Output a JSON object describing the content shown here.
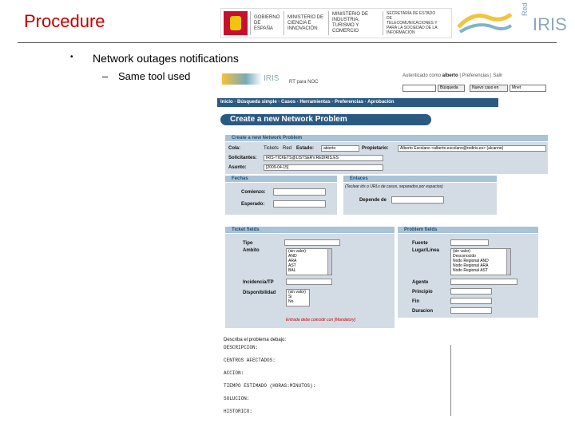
{
  "slide": {
    "title": "Procedure",
    "bullet_marker": "•",
    "bullet1": "Network outages notifications",
    "subbullet_dash": "–",
    "subbullet1": "Same tool used"
  },
  "header_logos": {
    "gov": "GOBIERNO DE ESPAÑA",
    "min1": "MINISTERIO DE CIENCIA E INNOVACIÓN",
    "min2": "MINISTERIO DE INDUSTRIA, TURISMO Y COMERCIO",
    "sec": "SECRETARÍA DE ESTADO DE TELECOMUNICACIONES Y PARA LA SOCIEDAD DE LA INFORMACIÓN",
    "red": "Red",
    "iris": "IRIS"
  },
  "app": {
    "logo_text": "IRIS",
    "subtitle": "RT para NOC",
    "auth_prefix": "Autenticado como",
    "user": "alberto",
    "prefs": "| Preferencias | Salir",
    "search_btn": "Búsqueda",
    "new_case_btn": "Nuevo caso en",
    "queue": "Mnet",
    "nav": "Inicio · Búsqueda simple · Casos · Herramientas · Preferencias · Aprobación",
    "page_heading": "Create a new Network Problem",
    "form_heading": "Create a new Network Problem",
    "cola_label": "Cola:",
    "ticket_label": "Tickets",
    "ticket_val": "Red",
    "estado_label": "Estado:",
    "estado_val": "abierto",
    "propietario_label": "Propietario:",
    "propietario_val": "Alberto Escolano <alberto.escolano@rediris.es> (alcanne)",
    "solicitantes_label": "Solicitantes:",
    "solicitantes_val": "IRIS-TICKETS@LISTSERV.REDIRIS.ES",
    "asunto_label": "Asunto:",
    "asunto_val": "[2009-04-15]",
    "fechas": "Fechas",
    "comienzo": "Comienzo:",
    "esperado": "Esperado:",
    "enlaces": "Enlaces",
    "enlaces_hint": "(Teclear ids o URLs de casos, separados por espacios)",
    "depende": "Depende de",
    "ticket_fields": "Ticket fields",
    "tipo": "Tipo",
    "ambito": "Ambito",
    "ambito_opts": [
      "(sin valor)",
      "AND",
      "ARA",
      "AST",
      "BAL"
    ],
    "incidencia": "Incidencia/TP",
    "disponibilidad": "Disponibilidad",
    "disp_opts": [
      "(sin valor)",
      "Si",
      "No"
    ],
    "mandatory": "Entrada debe coincidir con [Mandatory]",
    "problem_fields": "Problem fields",
    "fuente": "Fuente",
    "lugar": "Lugar/Línea",
    "lugar_opts": [
      "(sin valor)",
      "Desconocido",
      "Nodo Regional AND",
      "Nodo Regional ARA",
      "Nodo Regional AST"
    ],
    "agente": "Agente",
    "principio": "Principio",
    "fin": "Fin",
    "duracion": "Duracion",
    "describe": "Describa el problema debajo:",
    "desc_lines": [
      "DESCRIPCION:",
      "CENTROS AFECTADOS:",
      "ACCION:",
      "TIEMPO ESTIMADO (HORAS:MINUTOS):",
      "SOLUCION:",
      "HISTORICO:"
    ]
  }
}
